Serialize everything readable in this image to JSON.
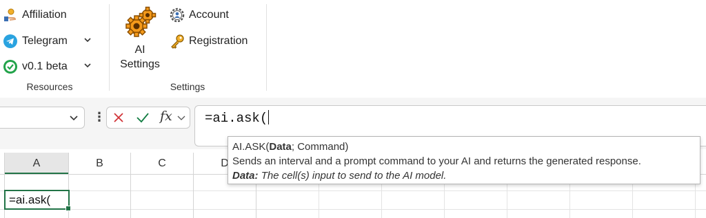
{
  "ribbon": {
    "resources": {
      "items": [
        {
          "label": "Affiliation",
          "icon": "affiliation-icon"
        },
        {
          "label": "Telegram",
          "icon": "telegram-icon",
          "dropdown": true
        },
        {
          "label": "v0.1 beta",
          "icon": "check-circle-icon",
          "dropdown": true
        }
      ],
      "group_label": "Resources"
    },
    "settings": {
      "ai_settings_line1": "AI",
      "ai_settings_line2": "Settings",
      "ai_settings_icon": "gears-icon",
      "items": [
        {
          "label": "Account",
          "icon": "account-gear-icon"
        },
        {
          "label": "Registration",
          "icon": "key-icon"
        }
      ],
      "group_label": "Settings"
    }
  },
  "formula_bar": {
    "name_box": "",
    "cancel_icon": "x-icon",
    "enter_icon": "check-icon",
    "fx_label": "fx",
    "formula": "=ai.ask("
  },
  "tooltip": {
    "function": "AI.ASK(",
    "arg_active": "Data",
    "arg_rest": "; Command)",
    "description": "Sends an interval and a prompt command to your AI and returns the generated response.",
    "arg_name": "Data:",
    "arg_description": "The cell(s) input to send to the AI model."
  },
  "grid": {
    "columns": [
      "A",
      "B",
      "C",
      "D"
    ],
    "active_cell_text": "=ai.ask("
  },
  "colors": {
    "accent": "#217346",
    "cancel": "#d13438",
    "enter": "#107c41",
    "telegram": "#2aa3e0",
    "beta": "#22a34a",
    "gear": "#f59a1a"
  }
}
